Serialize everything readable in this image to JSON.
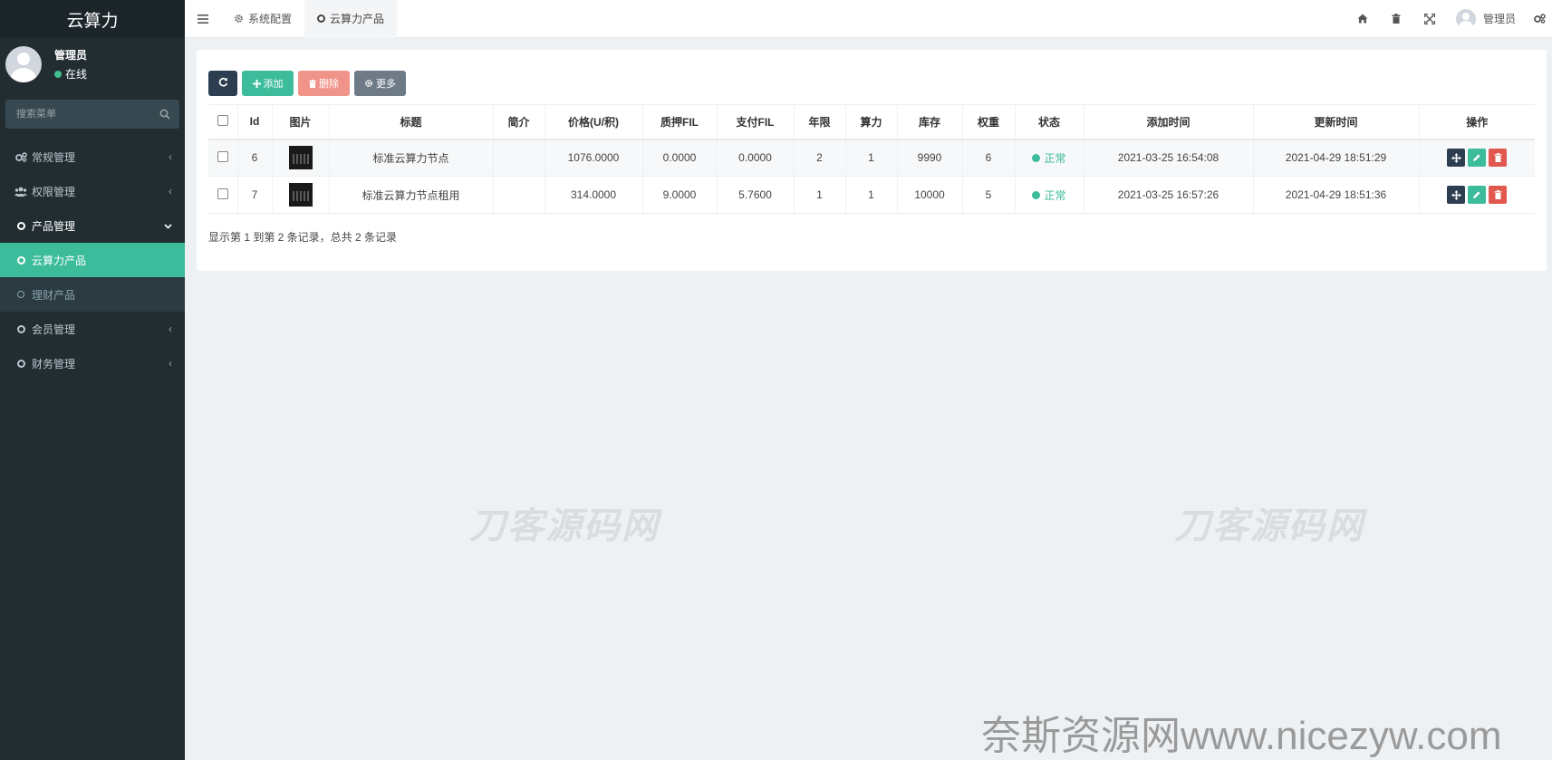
{
  "brand": "云算力",
  "user": {
    "name": "管理员",
    "status": "在线"
  },
  "search": {
    "placeholder": "搜索菜单"
  },
  "menu": [
    {
      "label": "常规管理",
      "icon": "cogs-icon",
      "expandable": true
    },
    {
      "label": "权限管理",
      "icon": "users-icon",
      "expandable": true
    },
    {
      "label": "产品管理",
      "icon": "circle-icon",
      "expandable": true,
      "open": true
    },
    {
      "label": "云算力产品",
      "icon": "circle-icon",
      "active": true
    },
    {
      "label": "理财产品",
      "icon": "circle-icon",
      "sub": true
    },
    {
      "label": "会员管理",
      "icon": "circle-icon",
      "expandable": true
    },
    {
      "label": "财务管理",
      "icon": "circle-icon",
      "expandable": true
    }
  ],
  "tabs": [
    {
      "label": "系统配置",
      "icon": "gear-icon"
    },
    {
      "label": "云算力产品",
      "icon": "circle-icon",
      "active": true
    }
  ],
  "topbar": {
    "user_name": "管理员"
  },
  "toolbar": {
    "add": "添加",
    "delete": "删除",
    "more": "更多"
  },
  "table": {
    "headers": [
      "Id",
      "图片",
      "标题",
      "简介",
      "价格(U/积)",
      "质押FIL",
      "支付FIL",
      "年限",
      "算力",
      "库存",
      "权重",
      "状态",
      "添加时间",
      "更新时间",
      "操作"
    ],
    "rows": [
      {
        "id": "6",
        "title": "标准云算力节点",
        "intro": "",
        "price": "1076.0000",
        "pledge": "0.0000",
        "pay": "0.0000",
        "years": "2",
        "power": "1",
        "stock": "9990",
        "weight": "6",
        "status": "正常",
        "created": "2021-03-25 16:54:08",
        "updated": "2021-04-29 18:51:29"
      },
      {
        "id": "7",
        "title": "标准云算力节点租用",
        "intro": "",
        "price": "314.0000",
        "pledge": "9.0000",
        "pay": "5.7600",
        "years": "1",
        "power": "1",
        "stock": "10000",
        "weight": "5",
        "status": "正常",
        "created": "2021-03-25 16:57:26",
        "updated": "2021-04-29 18:51:36"
      }
    ]
  },
  "pager_info": "显示第 1 到第 2 条记录，总共 2 条记录",
  "watermarks": {
    "center": "刀客源码网",
    "bottom": "奈斯资源网www.nicezyw.com"
  },
  "colors": {
    "sidebar": "#222d32",
    "accent": "#3cbc9b",
    "danger": "#e0584e",
    "dark": "#2c3e50"
  }
}
